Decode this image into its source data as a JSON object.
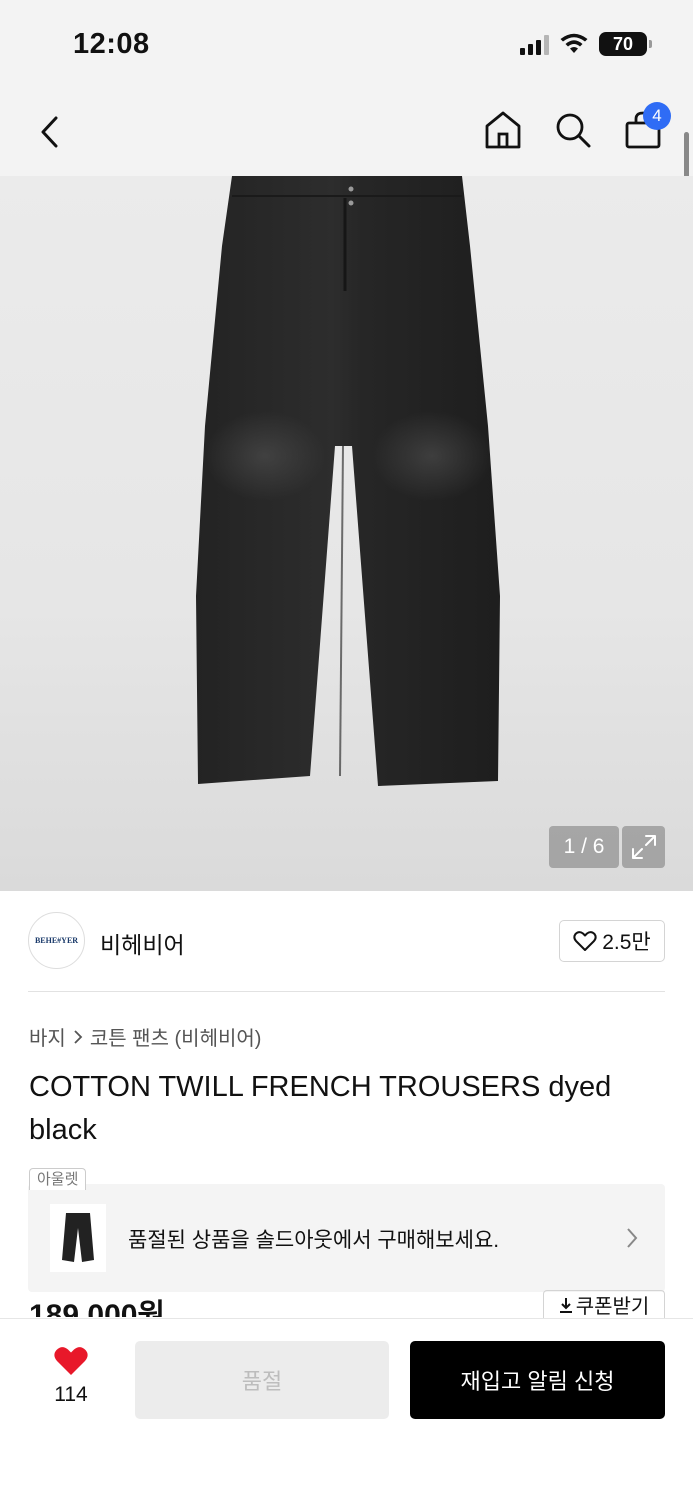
{
  "status_bar": {
    "time": "12:08",
    "battery": "70"
  },
  "nav": {
    "cart_count": "4"
  },
  "gallery": {
    "counter": "1 / 6"
  },
  "brand": {
    "logo_text": "BEHE#YER",
    "name": "비헤비어",
    "wish_count": "2.5만"
  },
  "breadcrumb": {
    "items": [
      "바지",
      "코튼 팬츠 (비헤비어)"
    ]
  },
  "product": {
    "title": "COTTON TWILL FRENCH TROUSERS dyed black",
    "price": "189,000원"
  },
  "outlet_banner": {
    "tag": "아울렛",
    "text": "품절된 상품을 솔드아웃에서 구매해보세요."
  },
  "coupon": {
    "label": "쿠폰받기"
  },
  "bottom_bar": {
    "like_count": "114",
    "soldout_label": "품절",
    "restock_label": "재입고 알림 신청"
  },
  "colors": {
    "accent_blue": "#2f6cf5",
    "heart_red": "#e8182a",
    "primary_black": "#000000"
  }
}
